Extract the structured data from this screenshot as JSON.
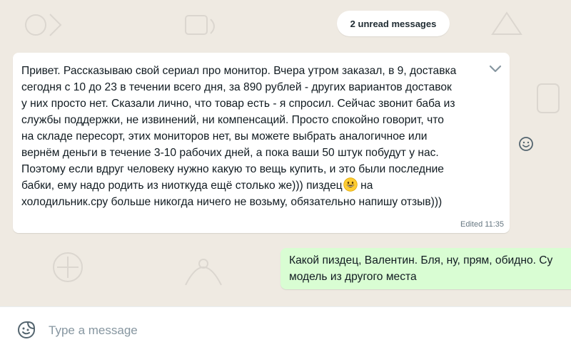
{
  "colors": {
    "chat_bg": "#efeae2",
    "incoming_bubble": "#ffffff",
    "outgoing_bubble": "#d9fdd3",
    "text": "#111b21",
    "meta_text": "#667781"
  },
  "unread_banner": {
    "label": "2 unread messages"
  },
  "incoming_message": {
    "lines": [
      "Привет. Рассказываю свой сериал про монитор. Вчера утром заказал, в 9, доставка",
      "сегодня с 10 до 23 в течении всего дня, за 890 рублей - других вариантов доставок",
      "у них просто нет. Сказали лично, что товар есть - я спросил. Сейчас звонит баба из",
      "службы поддержки, не извинений, ни компенсаций. Просто спокойно говорит, что",
      "на складе пересорт, этих мониторов нет, вы можете выбрать аналогичное или",
      "вернём деньги в течение 3-10 рабочих дней, а пока ваши 50 штук побудут у нас.",
      "Поэтому если вдруг человеку нужно какую то вещь купить, и это были последние",
      "бабки, ему надо родить из ниоткуда ещё столько же))) пиздец",
      "холодильник.сру больше никогда ничего не возьму, обязательно напишу отзыв)))"
    ],
    "line8_after_emoji": " на",
    "emoji": "grinning-face",
    "edited_label": "Edited",
    "time": "11:35",
    "menu_icon": "chevron-down-icon",
    "react_icon": "smiley-icon"
  },
  "outgoing_message": {
    "lines": [
      "Какой пиздец, Валентин. Бля, ну, прям, обидно. Су",
      "модель из другого места"
    ]
  },
  "composer": {
    "emoji_icon": "sticker-emoji-icon",
    "placeholder": "Type a message",
    "value": ""
  }
}
